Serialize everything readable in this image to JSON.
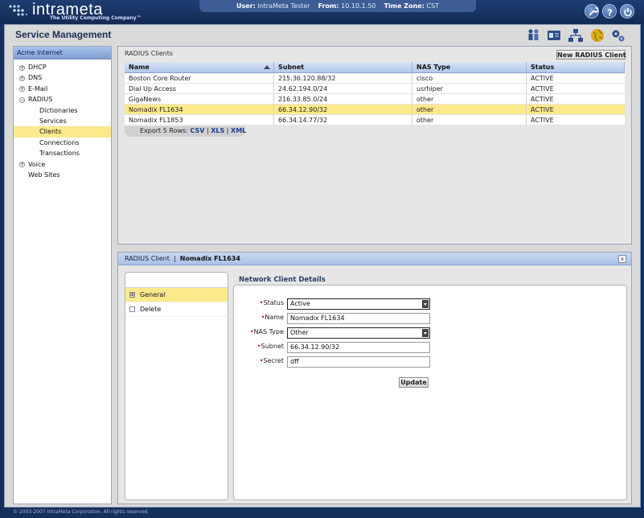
{
  "brand": {
    "name": "intrameta",
    "tagline": "The Utility Computing Company™"
  },
  "session": {
    "user_label": "User:",
    "user_value": "IntraMeta Tester",
    "from_label": "From:",
    "from_value": "10.10.1.50",
    "tz_label": "Time Zone:",
    "tz_value": "CST"
  },
  "top_icons": [
    "tools-icon",
    "help-icon",
    "power-icon"
  ],
  "page_title": "Service Management",
  "header_icons": [
    "users-icon",
    "id-card-icon",
    "network-icon",
    "globe-icon",
    "gears-icon"
  ],
  "sidebar": {
    "title": "Acme Internet",
    "items": [
      {
        "label": "DHCP",
        "level": 1,
        "expander": "+"
      },
      {
        "label": "DNS",
        "level": 1,
        "expander": "+"
      },
      {
        "label": "E-Mail",
        "level": 1,
        "expander": "+"
      },
      {
        "label": "RADIUS",
        "level": 1,
        "expander": "−"
      },
      {
        "label": "Dictionaries",
        "level": 2
      },
      {
        "label": "Services",
        "level": 2
      },
      {
        "label": "Clients",
        "level": 2,
        "selected": true
      },
      {
        "label": "Connections",
        "level": 2
      },
      {
        "label": "Transactions",
        "level": 2
      },
      {
        "label": "Voice",
        "level": 1,
        "expander": "+"
      },
      {
        "label": "Web Sites",
        "level": 1
      }
    ]
  },
  "clients": {
    "title": "RADIUS Clients",
    "new_button": "New RADIUS Client",
    "columns": [
      "Name",
      "Subnet",
      "NAS Type",
      "Status"
    ],
    "rows": [
      [
        "Boston Core Router",
        "215.36.120.88/32",
        "cisco",
        "ACTIVE"
      ],
      [
        "Dial Up Access",
        "24.62.194.0/24",
        "usrhiper",
        "ACTIVE"
      ],
      [
        "GigaNews",
        "216.33.85.0/24",
        "other",
        "ACTIVE"
      ],
      [
        "Nomadix FL1634",
        "66.34.12.90/32",
        "other",
        "ACTIVE"
      ],
      [
        "Nomadix FL1853",
        "66.34.14.77/32",
        "other",
        "ACTIVE"
      ]
    ],
    "selected_row": 3,
    "export": {
      "label": "Export 5 Rows:",
      "csv": "CSV",
      "xls": "XLS",
      "xml": "XML",
      "sep": "|"
    }
  },
  "detail": {
    "section": "RADIUS Client",
    "divider": "|",
    "name": "Nomadix FL1634",
    "close": "x",
    "nav": [
      {
        "label": "General",
        "icon": "⊞",
        "selected": true
      },
      {
        "label": "Delete",
        "icon": ""
      }
    ],
    "form_title": "Network Client Details",
    "fields": [
      {
        "label": "Status",
        "value": "Active",
        "type": "select"
      },
      {
        "label": "Name",
        "value": "Nomadix FL1634",
        "type": "text"
      },
      {
        "label": "NAS Type",
        "value": "Other",
        "type": "select"
      },
      {
        "label": "Subnet",
        "value": "66.34.12.90/32",
        "type": "text"
      },
      {
        "label": "Secret",
        "value": "dff",
        "type": "text"
      }
    ],
    "required_mark": "•",
    "update_button": "Update"
  },
  "footer": "© 2003-2007 IntraMeta Corporation.  All rights reserved."
}
